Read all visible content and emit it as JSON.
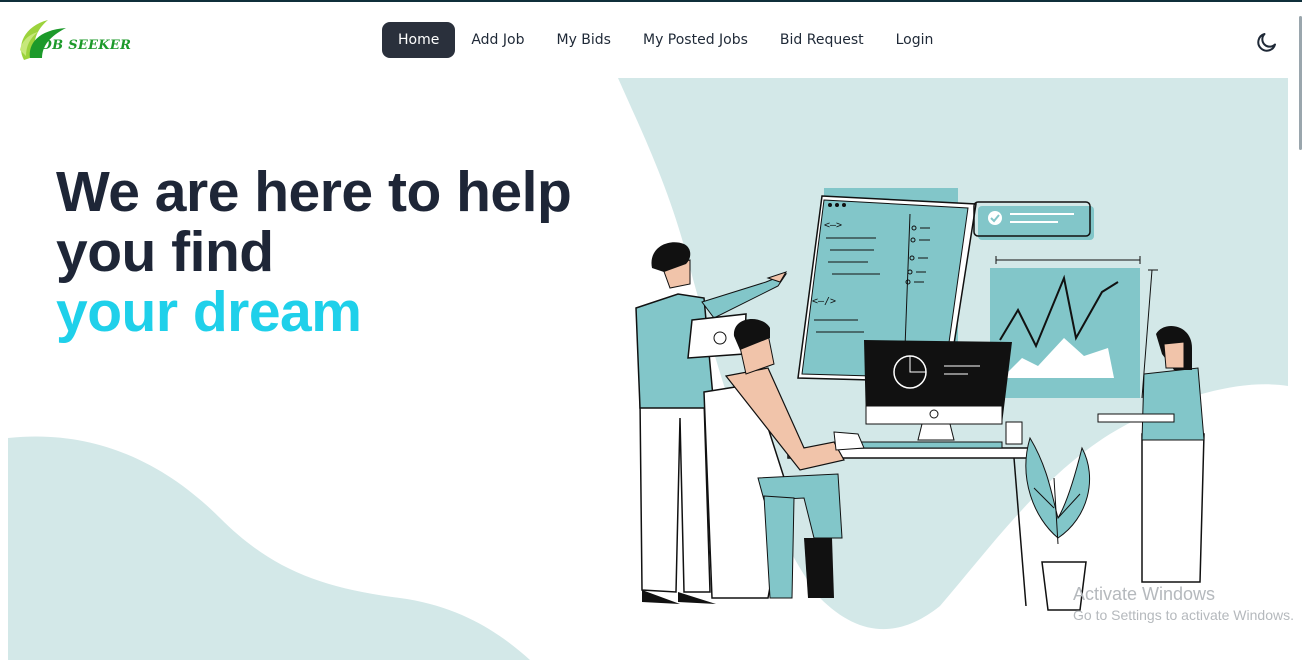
{
  "brand": {
    "logo_text": "JOB SEEKER",
    "colors": {
      "green": "#1c9a2a",
      "lime": "#9cd33c"
    }
  },
  "nav": {
    "items": [
      {
        "label": "Home",
        "active": true
      },
      {
        "label": "Add Job",
        "active": false
      },
      {
        "label": "My Bids",
        "active": false
      },
      {
        "label": "My Posted Jobs",
        "active": false
      },
      {
        "label": "Bid Request",
        "active": false
      },
      {
        "label": "Login",
        "active": false
      }
    ],
    "theme_toggle_icon": "moon-icon"
  },
  "hero": {
    "line1": "We are here to help",
    "line2": "you find",
    "line3": "your dream",
    "colors": {
      "text": "#1e2637",
      "accent": "#1fd0ea",
      "blob": "#d3e8e8",
      "teal": "#82c6c9"
    }
  },
  "watermark": {
    "title": "Activate Windows",
    "subtitle": "Go to Settings to activate Windows."
  }
}
